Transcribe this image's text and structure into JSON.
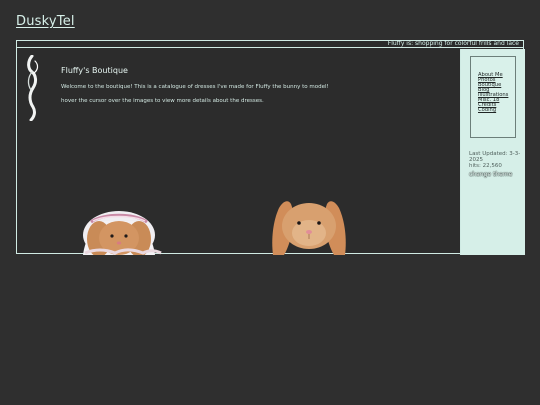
{
  "site": {
    "title": "DuskyTel"
  },
  "status": {
    "text": "Fluffy is: shopping for colorful frills and lace"
  },
  "content": {
    "heading": "Fluffy's Boutique",
    "intro": "Welcome to the boutique! This is a catalogue of dresses I've made for Fluffy the bunny to model!",
    "hint": "hover the cursor over the images to view more details about the dresses."
  },
  "sidebar": {
    "nav": [
      {
        "label": "About Me"
      },
      {
        "label": "Photos"
      },
      {
        "label": "Boutique"
      },
      {
        "label": "Blog"
      },
      {
        "label": "Illustrations"
      },
      {
        "label": "Misc. 18"
      },
      {
        "label": "Credits"
      },
      {
        "label": "Coding"
      }
    ],
    "last_updated": "Last Updated: 3-3-2025",
    "hits": "hits: 22,560",
    "change_theme": "change theme"
  }
}
